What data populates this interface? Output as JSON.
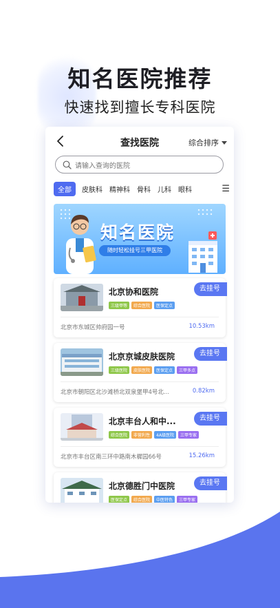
{
  "hero": {
    "title": "知名医院推荐",
    "subtitle": "快速找到擅长专科医院"
  },
  "nav": {
    "title": "查找医院",
    "sort_label": "综合排序"
  },
  "search": {
    "placeholder": "请输入查询的医院"
  },
  "tabs": [
    "全部",
    "皮肤科",
    "精神科",
    "骨科",
    "儿科",
    "眼科"
  ],
  "banner": {
    "title": "知名医院",
    "subtitle": "随时轻松挂号三甲医院"
  },
  "colors": {
    "accent": "#4f6bf0",
    "tag_green": "#8fc74a",
    "tag_orange": "#f2a94e",
    "tag_blue": "#5b9ef0",
    "tag_purple": "#9a6ff0",
    "wave": "#5a74ee"
  },
  "hospitals": [
    {
      "name": "北京协和医院",
      "button": "去挂号",
      "tags": [
        "三级甲等",
        "综合医院",
        "医保定点"
      ],
      "address": "北京市东城区帅府园一号",
      "distance": "10.53km"
    },
    {
      "name": "北京京城皮肤医院",
      "button": "去挂号",
      "tags": [
        "三级医院",
        "皮肤医院",
        "医保定点",
        "三甲多点"
      ],
      "address": "北京市朝阳区北沙滩桥北双泉堡甲4号北...",
      "distance": "0.82km"
    },
    {
      "name": "北京丰台人和中...",
      "button": "去挂号",
      "tags": [
        "综合医院",
        "非营利性",
        "4A级医院",
        "三甲专家"
      ],
      "address": "北京市丰台区南三环中路南木樨园66号",
      "distance": "15.26km"
    },
    {
      "name": "北京德胜门中医院",
      "button": "去挂号",
      "tags": [
        "医保定点",
        "综合医院",
        "中医特色",
        "三甲专家"
      ],
      "address": "",
      "distance": ""
    }
  ]
}
